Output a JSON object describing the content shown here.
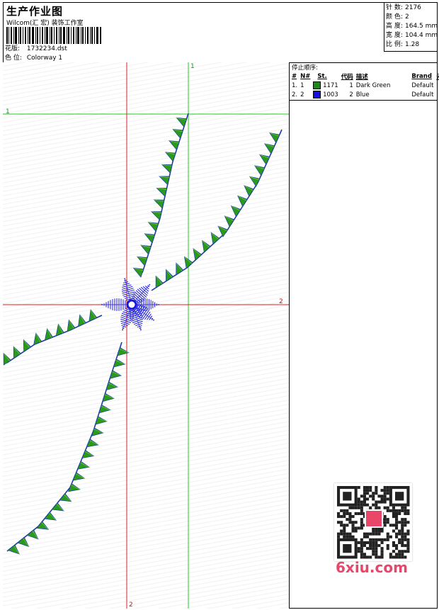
{
  "header": {
    "title": "生产作业图",
    "company": "Wilcom(汇 宏) 装饰工作室",
    "design_label": "花版:",
    "design_value": "1732234.dst",
    "color_label": "色 位:",
    "color_value": "Colorway 1"
  },
  "stats": [
    {
      "label": "针 数:",
      "value": "2176"
    },
    {
      "label": "颜 色:",
      "value": "2"
    },
    {
      "label": "高 度:",
      "value": "164.5 mm"
    },
    {
      "label": "宽 度:",
      "value": "104.4 mm"
    },
    {
      "label": "比 例:",
      "value": "1.28"
    }
  ],
  "stop_sequence": {
    "caption": "停止顺序:",
    "headers": [
      "#",
      "N#",
      "St.",
      "代码",
      "描述",
      "Brand",
      "元素"
    ],
    "rows": [
      {
        "num": "1.",
        "n": "1",
        "color": "#1a8a1a",
        "st": "1171",
        "code": "1",
        "desc": "Dark Green",
        "brand": "Default"
      },
      {
        "num": "2.",
        "n": "2",
        "color": "#1010e0",
        "st": "1003",
        "code": "2",
        "desc": "Blue",
        "brand": "Default"
      }
    ]
  },
  "guides": {
    "green_v_label": "1",
    "green_h_label": "1",
    "red_h_label": "2",
    "red_v_label": "2"
  },
  "colors": {
    "green_thread": "#2a9a1a",
    "blue_thread": "#1818d8",
    "green_guide": "#22cc22",
    "red_guide": "#dd2222"
  },
  "watermark": "6xiu.com"
}
